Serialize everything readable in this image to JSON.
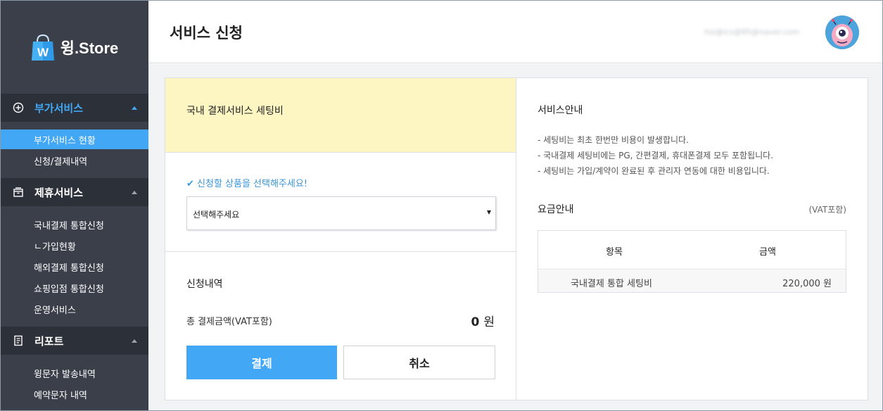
{
  "app": {
    "logo_text": "윙.Store",
    "logo_letter": "W"
  },
  "header": {
    "title": "서비스 신청",
    "user_email": "hiz@ics@95@naver.com"
  },
  "sidebar": {
    "sections": [
      {
        "title": "부가서비스",
        "icon": "plus-circle-icon",
        "active": true,
        "items": [
          "부가서비스 현황",
          "신청/결제내역"
        ]
      },
      {
        "title": "제휴서비스",
        "icon": "box-icon",
        "active": false,
        "items": [
          "국내결제 통합신청",
          "ㄴ가입현황",
          "해외결제 통합신청",
          "쇼핑입점 통합신청",
          "운영서비스"
        ]
      },
      {
        "title": "리포트",
        "icon": "report-icon",
        "active": false,
        "items": [
          "윙문자 발송내역",
          "예약문자 내역"
        ]
      }
    ]
  },
  "left_panel": {
    "service_name": "국내 결제서비스 세팅비",
    "select_prompt": "✔ 신청할 상품을 선택해주세요!",
    "select_value": "선택해주세요",
    "history_title": "신청내역",
    "total_label": "총 결제금액(VAT포함)",
    "total_amount": "0",
    "total_unit": "원",
    "pay_label": "결제",
    "cancel_label": "취소"
  },
  "right_panel": {
    "info_title": "서비스안내",
    "info_lines": [
      "- 세팅비는 최초 한번만 비용이 발생합니다.",
      "- 국내결제 세팅비에는 PG, 간편결제, 휴대폰결제 모두 포함됩니다.",
      "- 세팅비는 가입/계약이 완료된 후 관리자 연동에 대한 비용입니다."
    ],
    "fee_title": "요금안내",
    "fee_vat": "(VAT포함)",
    "table": {
      "headers": [
        "항목",
        "금액"
      ],
      "rows": [
        {
          "item": "국내결제 통합 세팅비",
          "amount": "220,000 원"
        }
      ]
    }
  },
  "colors": {
    "accent": "#42a8f5",
    "sidebar_bg": "#3a3f4a",
    "banner_bg": "#fdf6c3"
  }
}
